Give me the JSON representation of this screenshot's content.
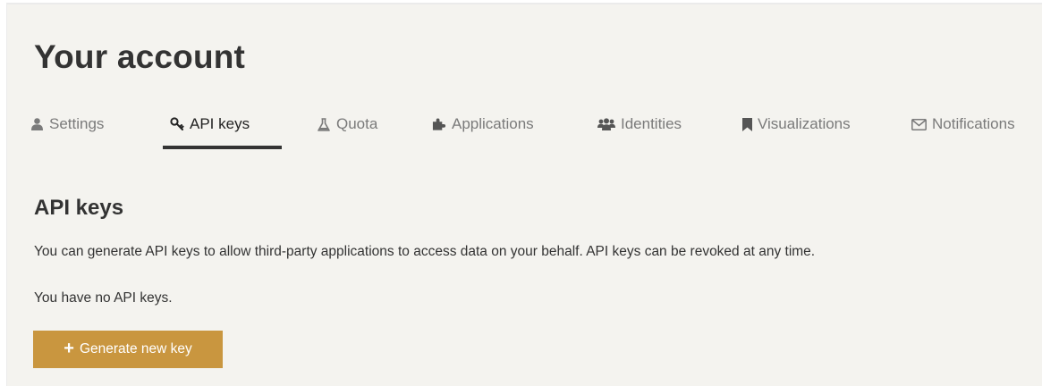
{
  "header": {
    "title": "Your account"
  },
  "tabs": [
    {
      "label": "Settings",
      "icon": "user-icon",
      "active": false
    },
    {
      "label": "API keys",
      "icon": "key-icon",
      "active": true
    },
    {
      "label": "Quota",
      "icon": "flask-icon",
      "active": false
    },
    {
      "label": "Applications",
      "icon": "puzzle-icon",
      "active": false
    },
    {
      "label": "Identities",
      "icon": "users-icon",
      "active": false
    },
    {
      "label": "Visualizations",
      "icon": "bookmark-icon",
      "active": false
    },
    {
      "label": "Notifications",
      "icon": "envelope-icon",
      "active": false
    }
  ],
  "api_keys": {
    "title": "API keys",
    "description": "You can generate API keys to allow third-party applications to access data on your behalf. API keys can be revoked at any time.",
    "empty_message": "You have no API keys.",
    "generate_button_label": "Generate new key",
    "generate_button_icon": "plus-icon"
  },
  "colors": {
    "background": "#f4f3ef",
    "accent_button": "#c9963f",
    "active_tab_underline": "#333333",
    "inactive_tab_text": "#7a7a7a"
  }
}
